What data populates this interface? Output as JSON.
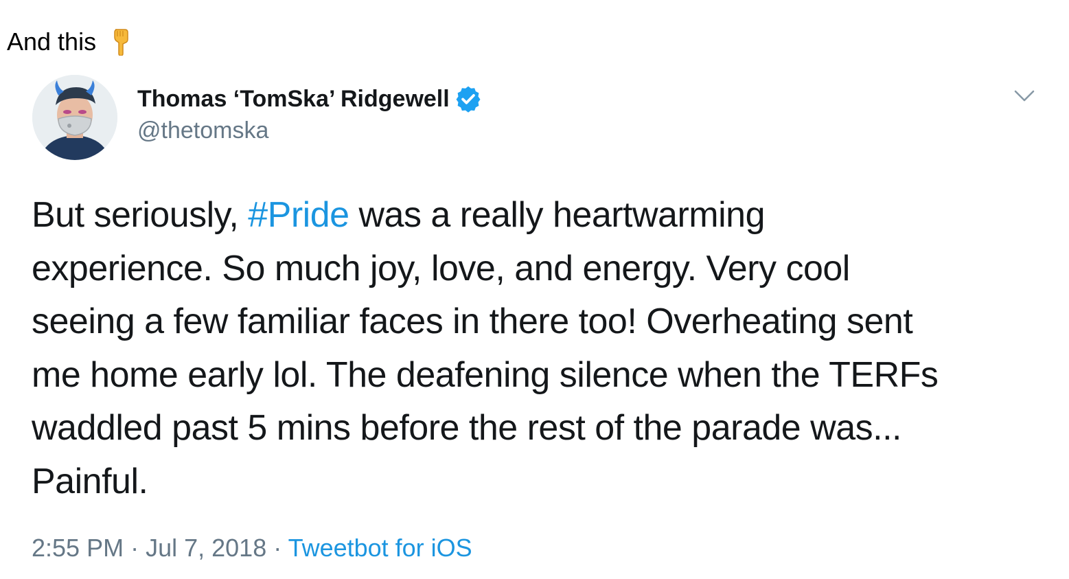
{
  "caption": {
    "text": "And this",
    "emoji_icon": "backhand-index-pointing-down-icon"
  },
  "tweet": {
    "display_name": "Thomas ‘TomSka’ Ridgewell",
    "handle": "@thetomska",
    "verified_icon": "verified-badge-icon",
    "menu_icon": "chevron-down-icon",
    "body": {
      "line1_pre": "But seriously, ",
      "hashtag": "#Pride",
      "line1_post": " was a really heartwarming",
      "line2": "experience. So much joy, love, and energy. Very cool",
      "line3": "seeing a few familiar faces in there too! Overheating sent",
      "line4": "me home early lol. The deafening silence when the TERFs",
      "line5": "waddled past 5 mins before the rest of the parade was...",
      "line6": "Painful."
    },
    "time": "2:55 PM",
    "separator": " · ",
    "date": "Jul 7, 2018",
    "source": "Tweetbot for iOS"
  },
  "colors": {
    "link_blue": "#1b95e0",
    "text_dark": "#14171a",
    "text_gray": "#657786",
    "verified_blue": "#1da1f2"
  }
}
